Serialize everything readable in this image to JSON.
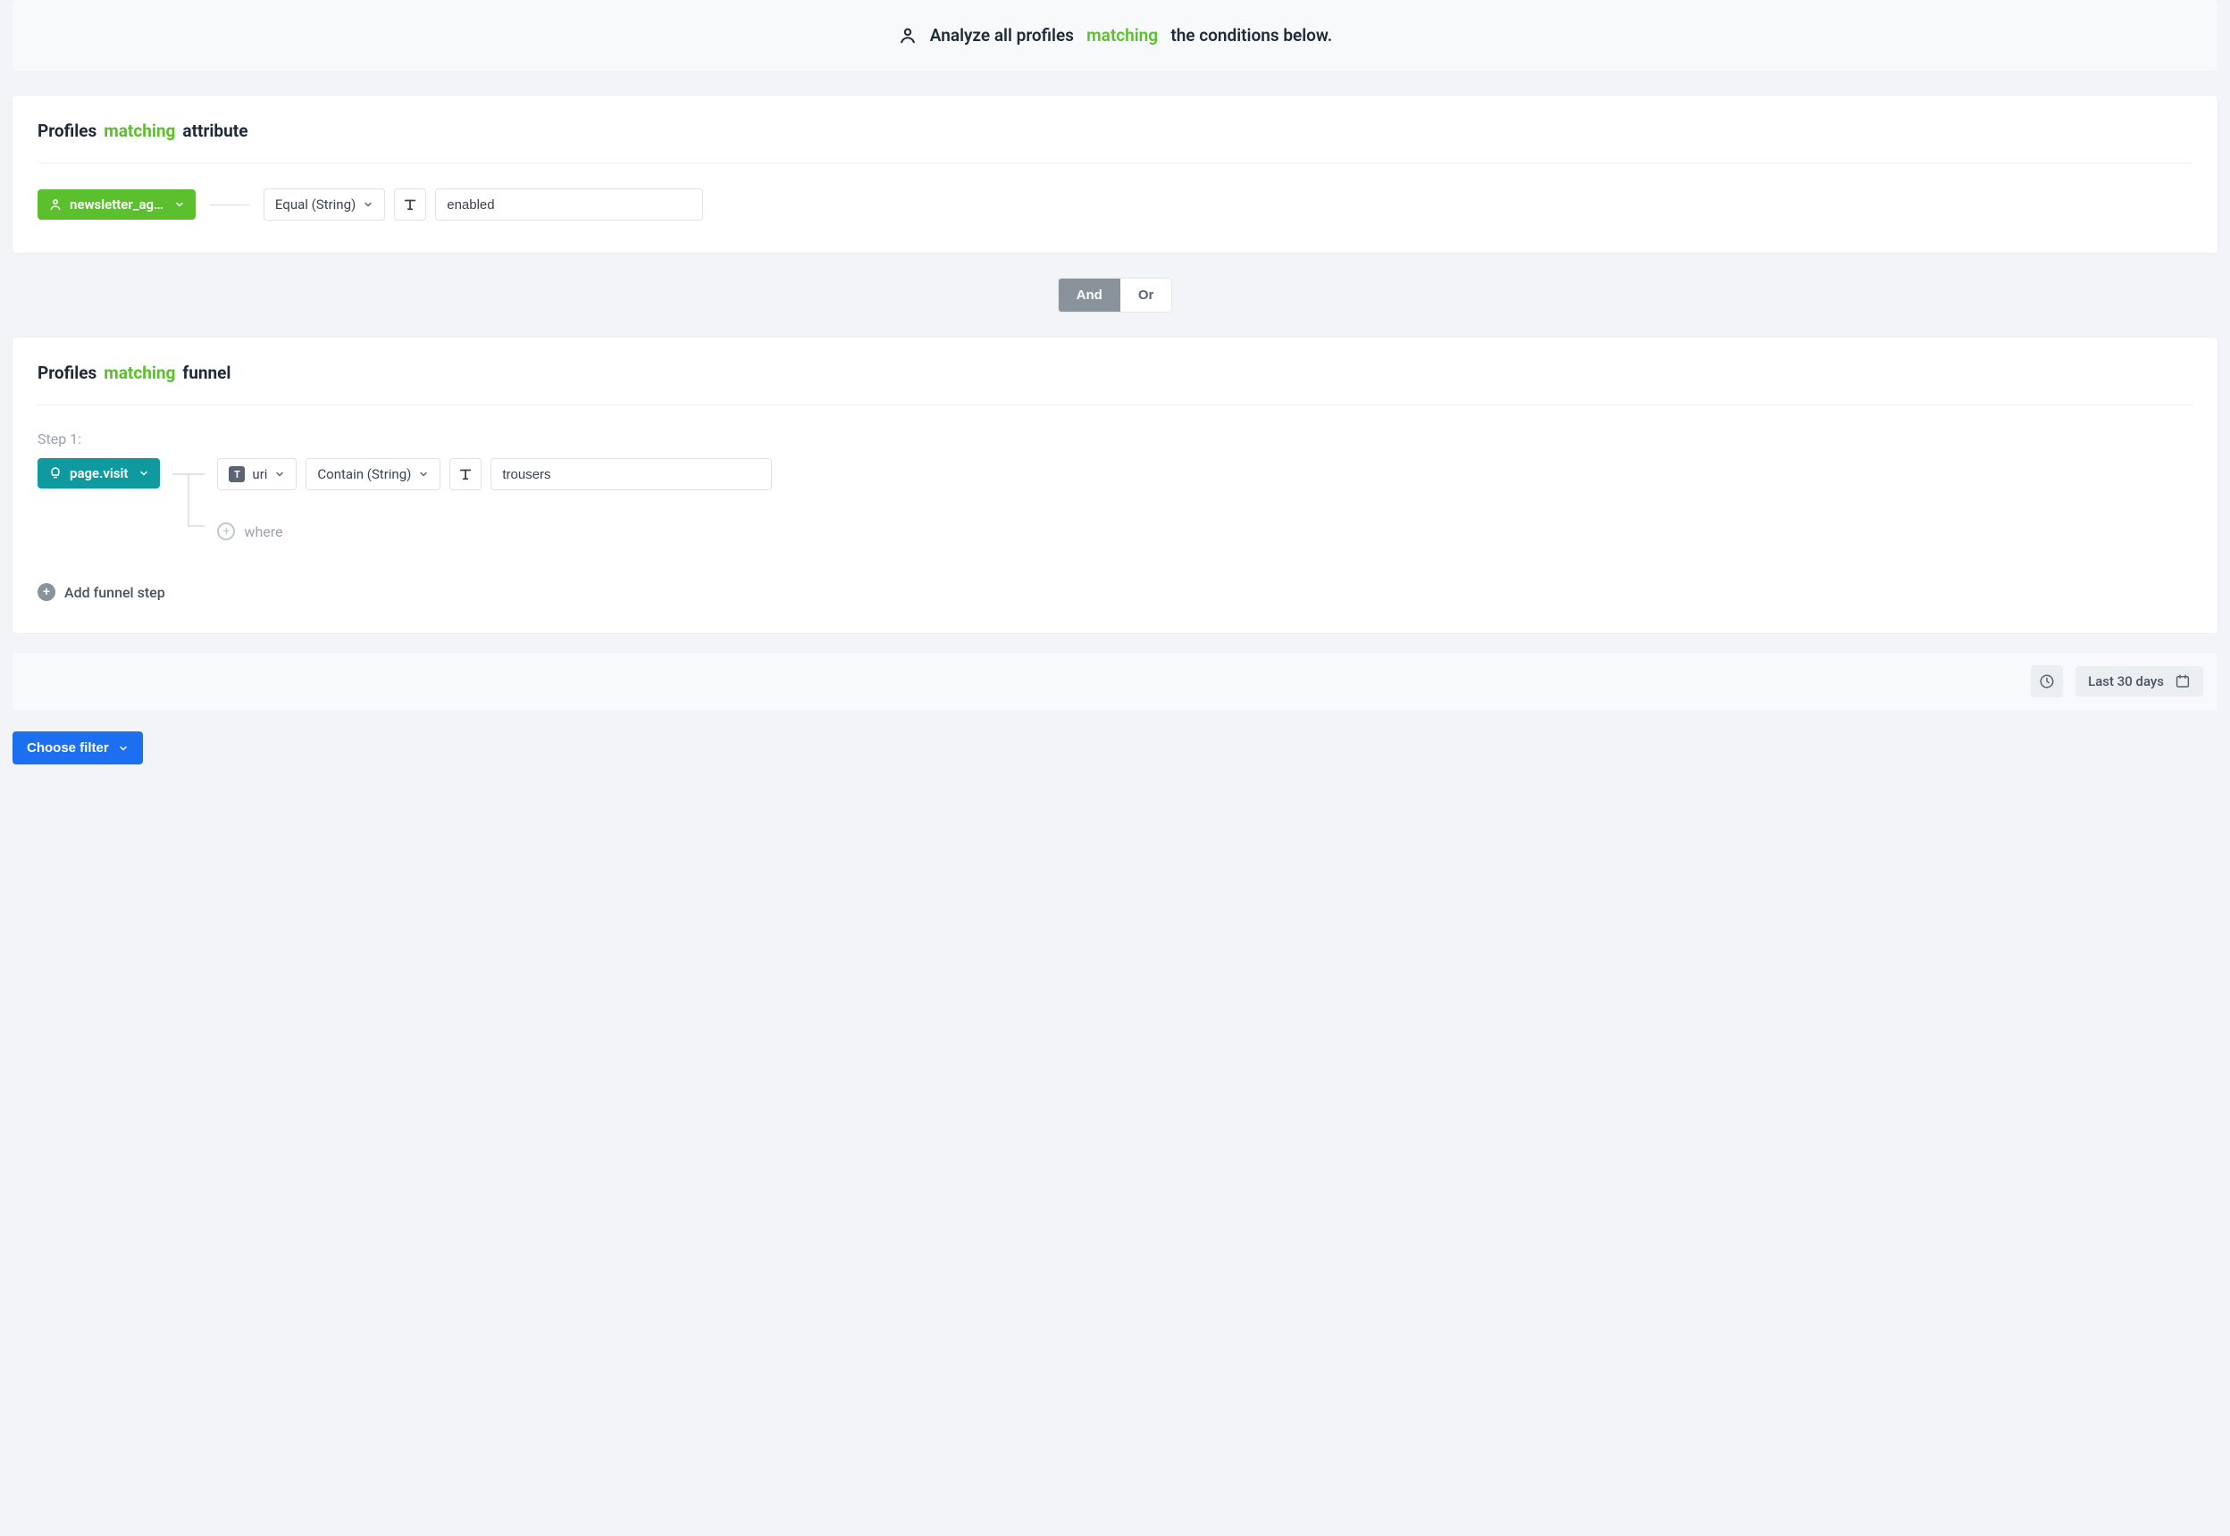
{
  "banner": {
    "prefix": "Analyze all profiles",
    "keyword": "matching",
    "suffix": "the conditions below."
  },
  "attribute_card": {
    "title_prefix": "Profiles",
    "title_keyword": "matching",
    "title_suffix": "attribute",
    "attribute_chip": "newsletter_ag…",
    "comparator": "Equal (String)",
    "value": "enabled"
  },
  "logic": {
    "and": "And",
    "or": "Or",
    "active": "and"
  },
  "funnel_card": {
    "title_prefix": "Profiles",
    "title_keyword": "matching",
    "title_suffix": "funnel",
    "step_label": "Step 1:",
    "event_chip": "page.visit",
    "property": "uri",
    "comparator": "Contain (String)",
    "value": "trousers",
    "where_label": "where",
    "add_step_label": "Add funnel step"
  },
  "footer": {
    "daterange_label": "Last 30 days"
  },
  "actions": {
    "choose_filter": "Choose filter"
  }
}
